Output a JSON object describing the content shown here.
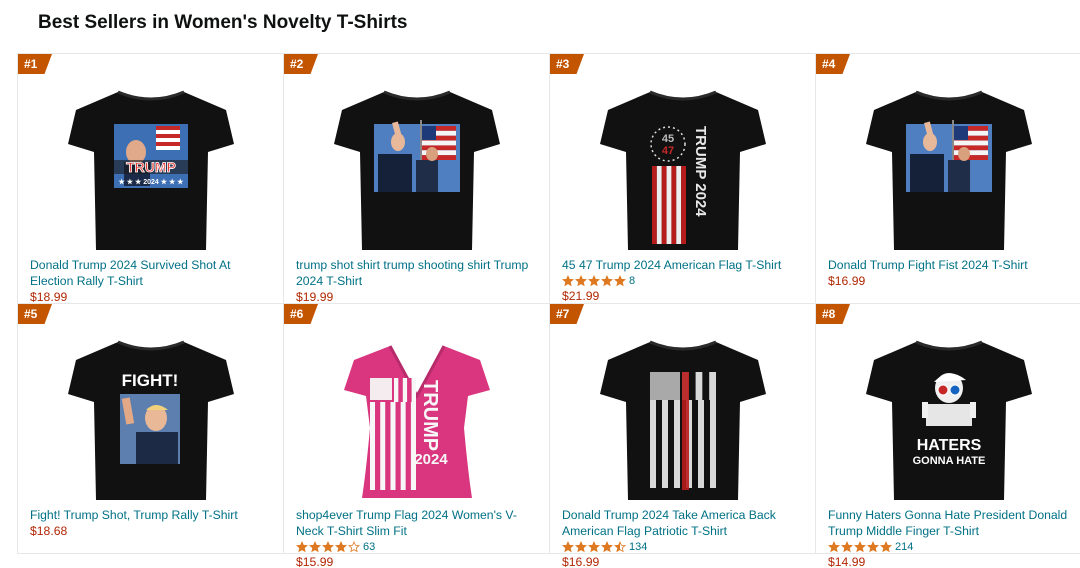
{
  "page": {
    "title": "Best Sellers in Women's Novelty T-Shirts"
  },
  "colors": {
    "rank_badge": "#c45500",
    "link": "#007185",
    "price": "#b12704",
    "star": "#de7921"
  },
  "products": [
    {
      "rank": "#1",
      "title": "Donald Trump 2024 Survived Shot At Election Rally T-Shirt",
      "price": "$18.99",
      "rating": null,
      "reviews": null,
      "shirt_color": "#111111",
      "shirt_style": "crew",
      "graphic": "photo-trump-2024",
      "graphic_text": [
        "TRUMP",
        "2024"
      ]
    },
    {
      "rank": "#2",
      "title": "trump shot shirt trump shooting shirt Trump 2024 T-Shirt",
      "price": "$19.99",
      "rating": null,
      "reviews": null,
      "shirt_color": "#111111",
      "shirt_style": "crew",
      "graphic": "photo-flag",
      "graphic_text": []
    },
    {
      "rank": "#3",
      "title": "45 47 Trump 2024 American Flag T-Shirt",
      "price": "$21.99",
      "rating": 5,
      "reviews": "8",
      "shirt_color": "#111111",
      "shirt_style": "crew",
      "graphic": "vertical-flag",
      "graphic_text": [
        "45",
        "47",
        "TRUMP 2024"
      ]
    },
    {
      "rank": "#4",
      "title": "Donald Trump Fight Fist 2024 T-Shirt",
      "price": "$16.99",
      "rating": null,
      "reviews": null,
      "shirt_color": "#111111",
      "shirt_style": "crew",
      "graphic": "photo-flag",
      "graphic_text": []
    },
    {
      "rank": "#5",
      "title": "Fight! Trump Shot, Trump Rally T-Shirt",
      "price": "$18.68",
      "rating": null,
      "reviews": null,
      "shirt_color": "#111111",
      "shirt_style": "crew",
      "graphic": "fight-photo",
      "graphic_text": [
        "FIGHT!"
      ]
    },
    {
      "rank": "#6",
      "title": "shop4ever Trump Flag 2024 Women's V-Neck T-Shirt Slim Fit",
      "price": "$15.99",
      "rating": 4,
      "reviews": "63",
      "shirt_color": "#d9367f",
      "shirt_style": "vneck",
      "graphic": "white-flag",
      "graphic_text": [
        "TRUMP",
        "2024"
      ]
    },
    {
      "rank": "#7",
      "title": "Donald Trump 2024 Take America Back American Flag Patriotic T-Shirt",
      "price": "$16.99",
      "rating": 4.5,
      "reviews": "134",
      "shirt_color": "#111111",
      "shirt_style": "crew",
      "graphic": "grunge-flag",
      "graphic_text": []
    },
    {
      "rank": "#8",
      "title": "Funny Haters Gonna Hate President Donald Trump Middle Finger T-Shirt",
      "price": "$14.99",
      "rating": 5,
      "reviews": "214",
      "shirt_color": "#111111",
      "shirt_style": "crew",
      "graphic": "haters",
      "graphic_text": [
        "HATERS",
        "GONNA HATE"
      ]
    }
  ]
}
